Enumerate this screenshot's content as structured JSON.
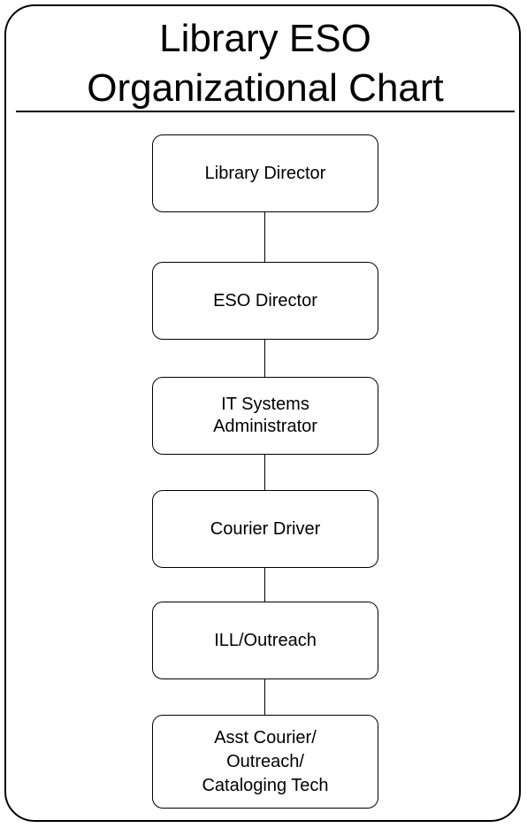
{
  "title": {
    "line1": "Library ESO",
    "line2": "Organizational Chart"
  },
  "nodes": [
    {
      "id": "library-director",
      "label": "Library Director"
    },
    {
      "id": "eso-director",
      "label": "ESO Director"
    },
    {
      "id": "it-systems-administrator",
      "label": "IT Systems\nAdministrator"
    },
    {
      "id": "courier-driver",
      "label": "Courier Driver"
    },
    {
      "id": "ill-outreach",
      "label": "ILL/Outreach"
    },
    {
      "id": "asst-courier-outreach-cataloging-tech",
      "label": "Asst Courier/\nOutreach/\nCataloging Tech"
    }
  ]
}
